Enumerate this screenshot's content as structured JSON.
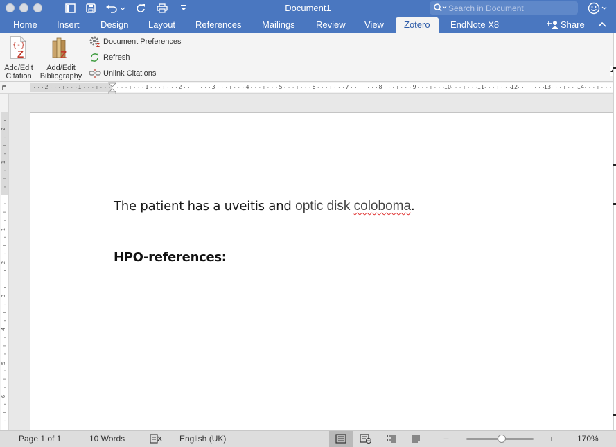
{
  "window": {
    "title": "Document1",
    "accent_color": "#4a77c0"
  },
  "toolbar": {
    "icons": [
      "sidebar-icon",
      "save-icon",
      "undo-icon",
      "redo-icon",
      "print-icon",
      "customize-icon"
    ]
  },
  "search": {
    "placeholder": "Search in Document"
  },
  "tabs": [
    {
      "label": "Home"
    },
    {
      "label": "Insert"
    },
    {
      "label": "Design"
    },
    {
      "label": "Layout"
    },
    {
      "label": "References"
    },
    {
      "label": "Mailings"
    },
    {
      "label": "Review"
    },
    {
      "label": "View"
    },
    {
      "label": "Zotero",
      "active": true
    },
    {
      "label": "EndNote X8"
    }
  ],
  "share": {
    "label": "Share"
  },
  "ribbon": {
    "add_edit_citation": {
      "line1": "Add/Edit",
      "line2": "Citation"
    },
    "add_edit_bibliography": {
      "line1": "Add/Edit",
      "line2": "Bibliography"
    },
    "document_preferences": "Document Preferences",
    "refresh": "Refresh",
    "unlink_citations": "Unlink Citations"
  },
  "ruler": {
    "left_labels": [
      "2",
      "1"
    ],
    "labels": [
      "1",
      "2",
      "3",
      "4",
      "5",
      "6",
      "7",
      "8",
      "9",
      "10",
      "11",
      "12",
      "13",
      "14"
    ],
    "vertical_labels": [
      "2",
      "1",
      "1",
      "2",
      "3",
      "4",
      "5",
      "6"
    ]
  },
  "document": {
    "para1_before": "The patient has a uveitis and ",
    "para1_cite_a": "optic disk ",
    "para1_cite_b": "coloboma",
    "para1_after": ".",
    "heading": "HPO-references:"
  },
  "status": {
    "page": "Page 1 of 1",
    "words": "10 Words",
    "language": "English (UK)",
    "zoom_minus": "−",
    "zoom_plus": "+",
    "zoom_level": 0.53,
    "zoom_label": "170%"
  }
}
